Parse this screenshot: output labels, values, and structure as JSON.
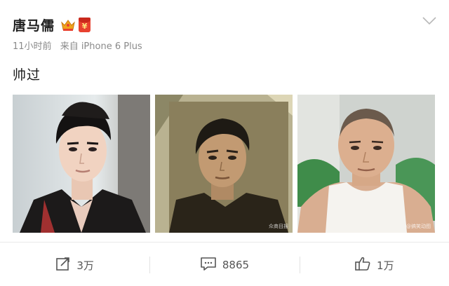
{
  "post": {
    "author": "唐马儒",
    "badges": {
      "crown": "crown-vip-icon",
      "red_packet": "red-packet-icon",
      "red_packet_symbol": "¥"
    },
    "time": "11小时前",
    "source": "来自 iPhone 6 Plus",
    "text": "帅过",
    "menu_icon": "chevron-down-icon",
    "images": [
      {
        "name": "photo-1",
        "watermark": ""
      },
      {
        "name": "photo-2",
        "watermark": "众商目报"
      },
      {
        "name": "photo-3",
        "watermark": "@搞笑动图"
      }
    ]
  },
  "actions": {
    "repost": {
      "icon": "repost-icon",
      "count": "3万"
    },
    "comment": {
      "icon": "comment-icon",
      "count": "8865"
    },
    "like": {
      "icon": "like-icon",
      "count": "1万"
    }
  },
  "colors": {
    "text_primary": "#1f1f1f",
    "text_secondary": "#8a8a8a",
    "badge_red": "#e8412f",
    "crown_gold": "#f0a31c"
  }
}
